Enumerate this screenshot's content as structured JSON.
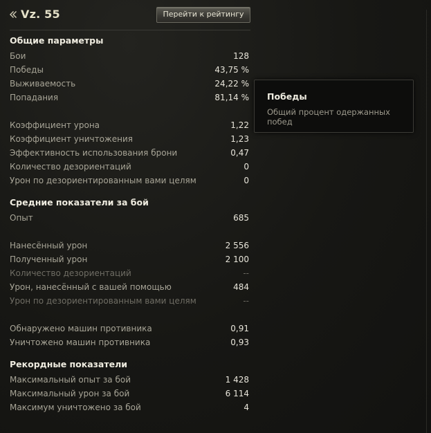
{
  "header": {
    "tank_name": "Vz. 55",
    "rating_button_label": "Перейти к рейтингу",
    "tier_icon": "double-chevron-icon"
  },
  "general": {
    "title": "Общие параметры",
    "rows": [
      {
        "label": "Бои",
        "value": "128"
      },
      {
        "label": "Победы",
        "value": "43,75 %"
      },
      {
        "label": "Выживаемость",
        "value": "24,22 %"
      },
      {
        "label": "Попадания",
        "value": "81,14 %"
      },
      {
        "label": "Коэффициент урона",
        "value": "1,22"
      },
      {
        "label": "Коэффициент уничтожения",
        "value": "1,23"
      },
      {
        "label": "Эффективность использования брони",
        "value": "0,47"
      },
      {
        "label": "Количество дезориентаций",
        "value": "0"
      },
      {
        "label": "Урон по дезориентированным вами целям",
        "value": "0"
      }
    ]
  },
  "average": {
    "title": "Средние показатели за бой",
    "rows": [
      {
        "label": "Опыт",
        "value": "685"
      },
      {
        "label": "Нанесённый урон",
        "value": "2 556"
      },
      {
        "label": "Полученный урон",
        "value": "2 100"
      },
      {
        "label": "Количество дезориентаций",
        "value": "--"
      },
      {
        "label": "Урон, нанесённый с вашей помощью",
        "value": "484"
      },
      {
        "label": "Урон по дезориентированным вами целям",
        "value": "--"
      },
      {
        "label": "Обнаружено машин противника",
        "value": "0,91"
      },
      {
        "label": "Уничтожено машин противника",
        "value": "0,93"
      }
    ]
  },
  "records": {
    "title": "Рекордные показатели",
    "rows": [
      {
        "label": "Максимальный опыт за бой",
        "value": "1 428"
      },
      {
        "label": "Максимальный урон за бой",
        "value": "6 114"
      },
      {
        "label": "Максимум уничтожено за бой",
        "value": "4"
      }
    ]
  },
  "tooltip": {
    "title": "Победы",
    "text": "Общий процент одержанных побед"
  }
}
